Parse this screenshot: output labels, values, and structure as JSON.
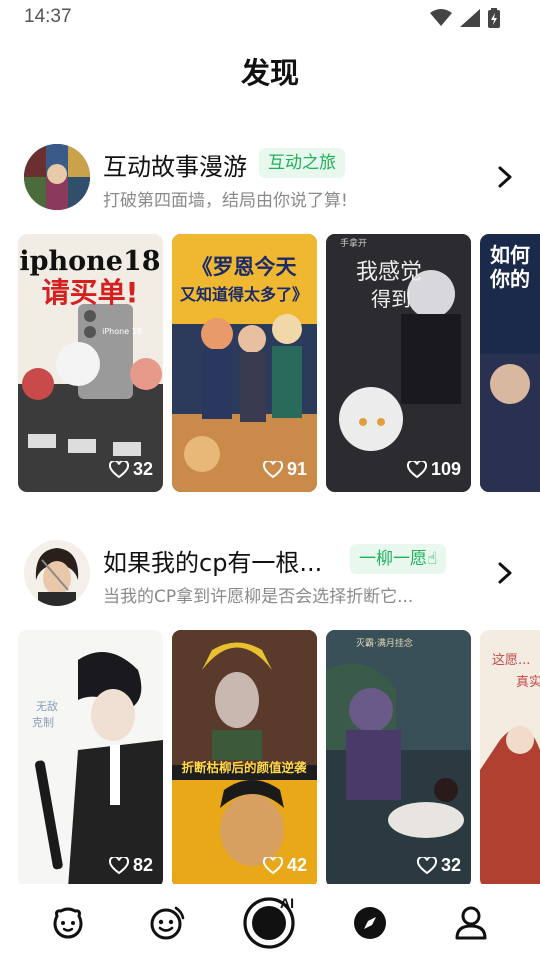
{
  "status_bar": {
    "time": "14:37"
  },
  "page": {
    "title": "发现"
  },
  "sections": [
    {
      "title": "互动故事漫游",
      "tag": "互动之旅",
      "subtitle": "打破第四面墙，结局由你说了算!",
      "cards": [
        {
          "caption_line1": "iphone18",
          "caption_line2": "请买单!",
          "badge": "iPhone 18",
          "likes": "32"
        },
        {
          "caption_line1": "《罗恩今天",
          "caption_line2": "又知道得太多了》",
          "likes": "91"
        },
        {
          "caption_line1": "我感觉",
          "caption_line2": "得到",
          "author_tag": "手拿开",
          "likes": "109"
        },
        {
          "caption_line1": "如何",
          "caption_line2": "你的"
        }
      ]
    },
    {
      "title": "如果我的cp有一根...",
      "tag": "一柳一愿☝",
      "subtitle": "当我的CP拿到许愿柳是否会选择折断它...",
      "cards": [
        {
          "caption_line1": "无敌",
          "caption_line2": "克制",
          "likes": "82"
        },
        {
          "caption_line1": "折断枯柳后的颜值逆袭",
          "likes": "42"
        },
        {
          "caption_line1": "灭霸·满月挂念",
          "likes": "32"
        },
        {
          "caption_line1": "这愿...",
          "caption_line2": "真实"
        }
      ]
    }
  ],
  "tabbar": {
    "items": [
      {
        "icon": "home-face-icon"
      },
      {
        "icon": "smile-icon"
      },
      {
        "icon": "camera-ai-icon",
        "label": "AI"
      },
      {
        "icon": "compass-icon"
      },
      {
        "icon": "profile-icon"
      }
    ]
  }
}
